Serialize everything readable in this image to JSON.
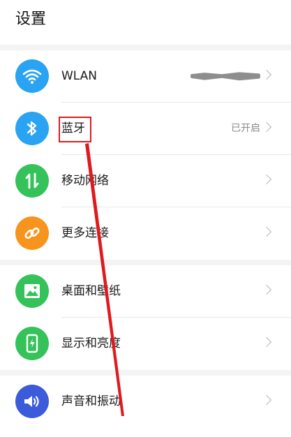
{
  "header": {
    "title": "设置"
  },
  "groups": [
    {
      "items": [
        {
          "id": "wlan",
          "label": "WLAN",
          "value": "",
          "icon": "wifi-icon",
          "color": "#2aa3f2",
          "value_redacted": true
        },
        {
          "id": "bluetooth",
          "label": "蓝牙",
          "value": "已开启",
          "icon": "bluetooth-icon",
          "color": "#2aa3f2"
        },
        {
          "id": "mobile-network",
          "label": "移动网络",
          "value": "",
          "icon": "mobile-data-icon",
          "color": "#35c25a"
        },
        {
          "id": "more-connections",
          "label": "更多连接",
          "value": "",
          "icon": "link-icon",
          "color": "#f7941d"
        }
      ]
    },
    {
      "items": [
        {
          "id": "wallpaper",
          "label": "桌面和壁纸",
          "value": "",
          "icon": "image-icon",
          "color": "#35c25a"
        },
        {
          "id": "display",
          "label": "显示和亮度",
          "value": "",
          "icon": "phone-brightness-icon",
          "color": "#35c25a"
        }
      ]
    },
    {
      "items": [
        {
          "id": "sound",
          "label": "声音和振动",
          "value": "",
          "icon": "speaker-icon",
          "color": "#3b5bdb"
        }
      ]
    }
  ],
  "annotation": {
    "color": "#e0191c",
    "target": "bluetooth"
  }
}
